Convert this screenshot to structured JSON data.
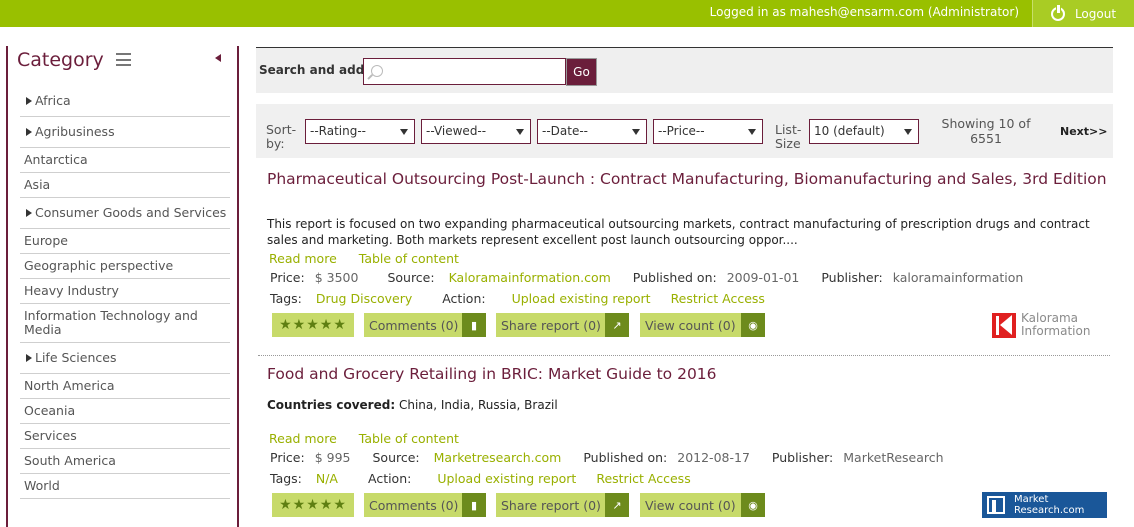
{
  "header": {
    "user_text": "Logged in as mahesh@ensarm.com (Administrator)",
    "logout_label": "Logout",
    "accent_color": "#99c000",
    "logout_icon": "power-icon"
  },
  "sidebar": {
    "title": "Category",
    "menu_icon": "hamburger-icon",
    "collapse_icon": "collapse-left-icon",
    "items": [
      {
        "label": "Africa",
        "expandable": true
      },
      {
        "label": "Agribusiness",
        "expandable": true
      },
      {
        "label": "Antarctica",
        "expandable": false
      },
      {
        "label": "Asia",
        "expandable": false
      },
      {
        "label": "Consumer Goods and Services",
        "expandable": true
      },
      {
        "label": "Europe",
        "expandable": false
      },
      {
        "label": "Geographic perspective",
        "expandable": false
      },
      {
        "label": "Heavy Industry",
        "expandable": false
      },
      {
        "label": "Information Technology and Media",
        "expandable": false
      },
      {
        "label": "Life Sciences",
        "expandable": true
      },
      {
        "label": "North America",
        "expandable": false
      },
      {
        "label": "Oceania",
        "expandable": false
      },
      {
        "label": "Services",
        "expandable": false
      },
      {
        "label": "South America",
        "expandable": false
      },
      {
        "label": "World",
        "expandable": false
      }
    ]
  },
  "search": {
    "label": "Search and add:",
    "placeholder": "",
    "value": "",
    "go_label": "Go",
    "icon": "search-icon"
  },
  "sort": {
    "label": "Sort-by:",
    "rating": "--Rating--",
    "viewed": "--Viewed--",
    "date": "--Date--",
    "price": "--Price--",
    "list_size_label": "List-Size",
    "list_size_value": "10 (default)",
    "showing": "Showing 10 of 6551",
    "next_label": "Next>>"
  },
  "labels": {
    "read_more": "Read more",
    "toc": "Table of content",
    "price": "Price:",
    "source": "Source:",
    "published": "Published on:",
    "publisher": "Publisher:",
    "tags": "Tags:",
    "action": "Action:",
    "upload": "Upload existing report",
    "restrict": "Restrict Access",
    "stars": "★★★★★",
    "comments_icon": "comment-icon",
    "share_icon": "share-icon",
    "view_icon": "eye-icon"
  },
  "reports": [
    {
      "title": "Pharmaceutical Outsourcing Post-Launch : Contract Manufacturing, Biomanufacturing and Sales, 3rd Edition",
      "description": "This report is focused on two expanding pharmaceutical outsourcing markets, contract manufacturing of prescription drugs and contract sales and marketing. Both markets represent excellent post launch outsourcing oppor....",
      "price": "$ 3500",
      "source": "Kaloramainformation.com",
      "published": "2009-01-01",
      "publisher": "kaloramainformation",
      "tag": "Drug Discovery",
      "comments": "Comments (0)",
      "share": "Share report (0)",
      "views": "View count (0)",
      "logo": "Kalorama Information"
    },
    {
      "title": "Food and Grocery Retailing in BRIC: Market Guide to 2016",
      "countries_label": "Countries covered:",
      "countries": "China, India, Russia, Brazil",
      "price": "$ 995",
      "source": "Marketresearch.com",
      "published": "2012-08-17",
      "publisher": "MarketResearch",
      "tag": "N/A",
      "comments": "Comments (0)",
      "share": "Share report (0)",
      "views": "View count (0)",
      "logo": "Market Research.com"
    }
  ]
}
